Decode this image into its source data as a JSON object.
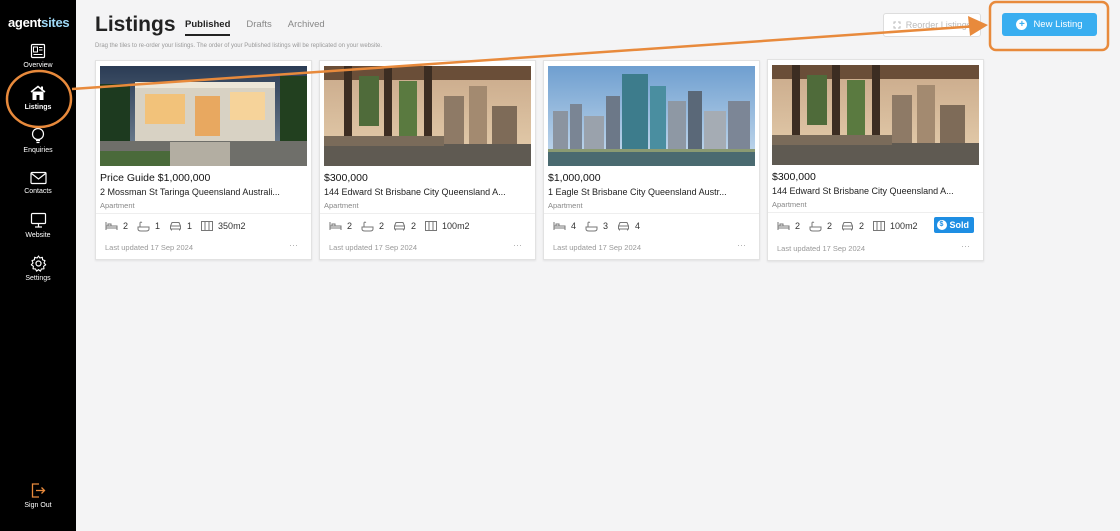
{
  "brand": {
    "logo_part1": "agent",
    "logo_part2": "sites"
  },
  "sidebar": {
    "items": [
      {
        "label": "Overview",
        "icon": "overview-icon"
      },
      {
        "label": "Listings",
        "icon": "home-icon"
      },
      {
        "label": "Enquiries",
        "icon": "lightbulb-icon"
      },
      {
        "label": "Contacts",
        "icon": "mail-icon"
      },
      {
        "label": "Website",
        "icon": "monitor-icon"
      },
      {
        "label": "Settings",
        "icon": "gear-icon"
      }
    ],
    "sign_out": "Sign Out"
  },
  "header": {
    "title": "Listings",
    "tabs": [
      {
        "label": "Published",
        "active": true
      },
      {
        "label": "Drafts",
        "active": false
      },
      {
        "label": "Archived",
        "active": false
      }
    ],
    "helper": "Drag the tiles to re-order your listings. The order of your Published listings will be replicated on your website.",
    "reorder_label": "Reorder Listings",
    "new_label": "New Listing"
  },
  "listings": [
    {
      "price": "Price Guide $1,000,000",
      "address": "2 Mossman St Taringa Queensland Australi...",
      "type": "Apartment",
      "bed": "2",
      "bath": "1",
      "car": "1",
      "area": "350m2",
      "updated": "Last updated 17 Sep 2024",
      "sold": false
    },
    {
      "price": "$300,000",
      "address": "144 Edward St Brisbane City Queensland A...",
      "type": "Apartment",
      "bed": "2",
      "bath": "2",
      "car": "2",
      "area": "100m2",
      "updated": "Last updated 17 Sep 2024",
      "sold": false
    },
    {
      "price": "$1,000,000",
      "address": "1 Eagle St Brisbane City Queensland Austr...",
      "type": "Apartment",
      "bed": "4",
      "bath": "3",
      "car": "4",
      "updated": "Last updated 17 Sep 2024",
      "sold": false
    },
    {
      "price": "$300,000",
      "address": "144 Edward St Brisbane City Queensland A...",
      "type": "Apartment",
      "bed": "2",
      "bath": "2",
      "car": "2",
      "area": "100m2",
      "updated": "Last updated 17 Sep 2024",
      "sold": true,
      "sold_label": "Sold"
    }
  ],
  "more_label": "···",
  "colors": {
    "accent": "#39aef0",
    "sold": "#1e8ee3",
    "annotation": "#e88a3c",
    "sidebar": "#000000"
  }
}
